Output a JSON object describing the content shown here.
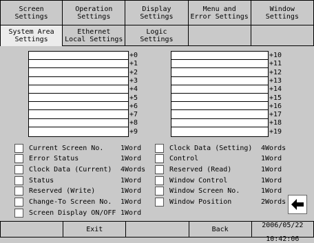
{
  "tabs_top": [
    {
      "label": "Screen\nSettings"
    },
    {
      "label": "Operation\nSettings"
    },
    {
      "label": "Display\nSettings"
    },
    {
      "label": "Menu and\nError Settings"
    },
    {
      "label": "Window\nSettings"
    }
  ],
  "tabs_second": [
    {
      "label": "System Area\nSettings",
      "active": true
    },
    {
      "label": "Ethernet\nLocal Settings"
    },
    {
      "label": "Logic\nSettings"
    },
    {
      "label": ""
    },
    {
      "label": ""
    }
  ],
  "system_area": {
    "left_labels": [
      "+0",
      "+1",
      "+2",
      "+3",
      "+4",
      "+5",
      "+6",
      "+7",
      "+8",
      "+9"
    ],
    "right_labels": [
      "+10",
      "+11",
      "+12",
      "+13",
      "+14",
      "+15",
      "+16",
      "+17",
      "+18",
      "+19"
    ]
  },
  "checkboxes_left": [
    {
      "label": "Current Screen No.",
      "size": "1Word"
    },
    {
      "label": "Error Status",
      "size": "1Word"
    },
    {
      "label": "Clock Data (Current)",
      "size": "4Words"
    },
    {
      "label": "Status",
      "size": "1Word"
    },
    {
      "label": "Reserved (Write)",
      "size": "1Word"
    },
    {
      "label": "Change-To Screen No.",
      "size": "1Word"
    },
    {
      "label": "Screen Display ON/OFF",
      "size": "1Word"
    }
  ],
  "checkboxes_right": [
    {
      "label": "Clock Data (Setting)",
      "size": "4Words"
    },
    {
      "label": "Control",
      "size": "1Word"
    },
    {
      "label": "Reserved (Read)",
      "size": "1Word"
    },
    {
      "label": "Window Control",
      "size": "1Word"
    },
    {
      "label": "Window Screen No.",
      "size": "1Word"
    },
    {
      "label": "Window Position",
      "size": "2Words"
    }
  ],
  "arrow": {
    "icon": "left-arrow-icon",
    "glyph": "⬅"
  },
  "bottom": {
    "exit_label": "Exit",
    "back_label": "Back",
    "date": "2006/05/22",
    "time": "10:42:06"
  }
}
